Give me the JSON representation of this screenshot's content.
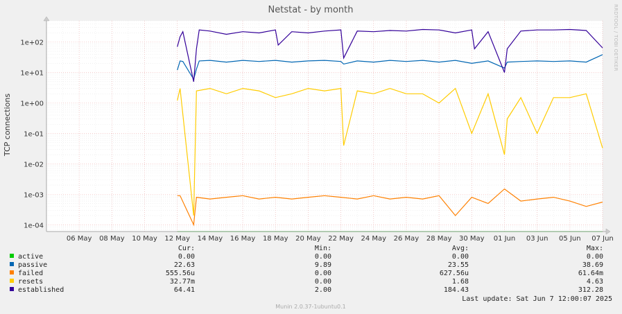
{
  "chart_data": {
    "type": "line",
    "title": "Netstat - by month",
    "ylabel": "TCP connections",
    "yscale": "log",
    "ylim": [
      6e-05,
      500
    ],
    "xlim": [
      "2025-05-04",
      "2025-06-07"
    ],
    "grid": true,
    "legend_position": "bottom",
    "x_ticks": [
      "06 May",
      "08 May",
      "10 May",
      "12 May",
      "14 May",
      "16 May",
      "18 May",
      "20 May",
      "22 May",
      "24 May",
      "26 May",
      "28 May",
      "30 May",
      "01 Jun",
      "03 Jun",
      "05 Jun",
      "07 Jun"
    ],
    "y_ticks": [
      "1e+02",
      "1e+01",
      "1e+00",
      "1e-01",
      "1e-02",
      "1e-03",
      "1e-04"
    ],
    "series": [
      {
        "name": "active",
        "color": "#00cc00",
        "x": [
          "2025-05-12",
          "2025-06-07"
        ],
        "values": [
          0.0,
          0.0
        ]
      },
      {
        "name": "passive",
        "color": "#0066b3",
        "x": [
          "2025-05-12",
          "2025-05-12",
          "2025-05-12",
          "2025-05-13",
          "2025-05-13",
          "2025-05-13",
          "2025-05-14",
          "2025-05-15",
          "2025-05-16",
          "2025-05-17",
          "2025-05-18",
          "2025-05-19",
          "2025-05-20",
          "2025-05-21",
          "2025-05-22",
          "2025-05-22",
          "2025-05-23",
          "2025-05-24",
          "2025-05-25",
          "2025-05-26",
          "2025-05-27",
          "2025-05-28",
          "2025-05-29",
          "2025-05-30",
          "2025-05-31",
          "2025-06-01",
          "2025-06-01",
          "2025-06-02",
          "2025-06-03",
          "2025-06-04",
          "2025-06-05",
          "2025-06-06",
          "2025-06-07"
        ],
        "values": [
          12,
          24,
          23,
          6,
          13,
          24,
          25,
          22,
          25,
          23,
          25,
          22,
          24,
          25,
          23,
          19,
          24,
          22,
          25,
          23,
          25,
          22,
          25,
          20,
          24,
          14,
          22,
          23,
          24,
          23,
          24,
          22,
          38.69
        ]
      },
      {
        "name": "failed",
        "color": "#ff8000",
        "x": [
          "2025-05-12",
          "2025-05-12",
          "2025-05-13",
          "2025-05-13",
          "2025-05-14",
          "2025-05-15",
          "2025-05-16",
          "2025-05-17",
          "2025-05-18",
          "2025-05-19",
          "2025-05-20",
          "2025-05-21",
          "2025-05-22",
          "2025-05-23",
          "2025-05-24",
          "2025-05-25",
          "2025-05-26",
          "2025-05-27",
          "2025-05-28",
          "2025-05-29",
          "2025-05-30",
          "2025-05-31",
          "2025-06-01",
          "2025-06-02",
          "2025-06-03",
          "2025-06-04",
          "2025-06-05",
          "2025-06-06",
          "2025-06-07"
        ],
        "values": [
          0.0009,
          0.0009,
          0.0001,
          0.0008,
          0.0007,
          0.0008,
          0.0009,
          0.0007,
          0.0008,
          0.0007,
          0.0008,
          0.0009,
          0.0008,
          0.0007,
          0.0009,
          0.0007,
          0.0008,
          0.0007,
          0.0009,
          0.0002,
          0.0008,
          0.0005,
          0.0015,
          0.0006,
          0.0007,
          0.0008,
          0.0006,
          0.0004,
          0.000556
        ]
      },
      {
        "name": "resets",
        "color": "#ffcc00",
        "x": [
          "2025-05-12",
          "2025-05-12",
          "2025-05-13",
          "2025-05-13",
          "2025-05-14",
          "2025-05-15",
          "2025-05-16",
          "2025-05-17",
          "2025-05-18",
          "2025-05-19",
          "2025-05-20",
          "2025-05-21",
          "2025-05-22",
          "2025-05-22",
          "2025-05-23",
          "2025-05-24",
          "2025-05-25",
          "2025-05-26",
          "2025-05-27",
          "2025-05-28",
          "2025-05-29",
          "2025-05-30",
          "2025-05-31",
          "2025-06-01",
          "2025-06-01",
          "2025-06-02",
          "2025-06-03",
          "2025-06-04",
          "2025-06-05",
          "2025-06-06",
          "2025-06-07"
        ],
        "values": [
          1.2,
          3.0,
          0.0002,
          2.5,
          3.0,
          2.0,
          3.0,
          2.5,
          1.5,
          2.0,
          3.0,
          2.5,
          3.0,
          0.04,
          2.5,
          2.0,
          3.0,
          2.0,
          2.0,
          1.0,
          3.0,
          0.1,
          2.0,
          0.02,
          0.3,
          1.5,
          0.1,
          1.5,
          1.5,
          2.0,
          0.0328
        ]
      },
      {
        "name": "established",
        "color": "#330099",
        "x": [
          "2025-05-12",
          "2025-05-12",
          "2025-05-12",
          "2025-05-13",
          "2025-05-13",
          "2025-05-13",
          "2025-05-14",
          "2025-05-15",
          "2025-05-16",
          "2025-05-17",
          "2025-05-18",
          "2025-05-18",
          "2025-05-19",
          "2025-05-20",
          "2025-05-21",
          "2025-05-22",
          "2025-05-22",
          "2025-05-23",
          "2025-05-24",
          "2025-05-25",
          "2025-05-26",
          "2025-05-27",
          "2025-05-28",
          "2025-05-29",
          "2025-05-30",
          "2025-05-30",
          "2025-05-31",
          "2025-06-01",
          "2025-06-01",
          "2025-06-02",
          "2025-06-03",
          "2025-06-04",
          "2025-06-05",
          "2025-06-06",
          "2025-06-07"
        ],
        "values": [
          70,
          150,
          220,
          5,
          60,
          250,
          230,
          180,
          220,
          200,
          250,
          80,
          220,
          200,
          230,
          250,
          30,
          230,
          220,
          240,
          230,
          260,
          250,
          200,
          250,
          60,
          220,
          10,
          60,
          230,
          250,
          250,
          260,
          240,
          64.41
        ]
      }
    ]
  },
  "legend": {
    "headers": {
      "cur": "Cur:",
      "min": "Min:",
      "avg": "Avg:",
      "max": "Max:"
    },
    "rows": [
      {
        "name": "active",
        "color": "#00cc00",
        "cur": "0.00",
        "min": "0.00",
        "avg": "0.00",
        "max": "0.00"
      },
      {
        "name": "passive",
        "color": "#0066b3",
        "cur": "22.63",
        "min": "9.89",
        "avg": "23.55",
        "max": "38.69"
      },
      {
        "name": "failed",
        "color": "#ff8000",
        "cur": "555.56u",
        "min": "0.00",
        "avg": "627.56u",
        "max": "61.64m"
      },
      {
        "name": "resets",
        "color": "#ffcc00",
        "cur": "32.77m",
        "min": "0.00",
        "avg": "1.68",
        "max": "4.63"
      },
      {
        "name": "established",
        "color": "#330099",
        "cur": "64.41",
        "min": "2.00",
        "avg": "184.43",
        "max": "312.28"
      }
    ]
  },
  "last_update": "Last update: Sat Jun  7 12:00:07 2025",
  "side_label": "RRDTOOL / TOBI OETIKER",
  "footer": "Munin 2.0.37-1ubuntu0.1"
}
